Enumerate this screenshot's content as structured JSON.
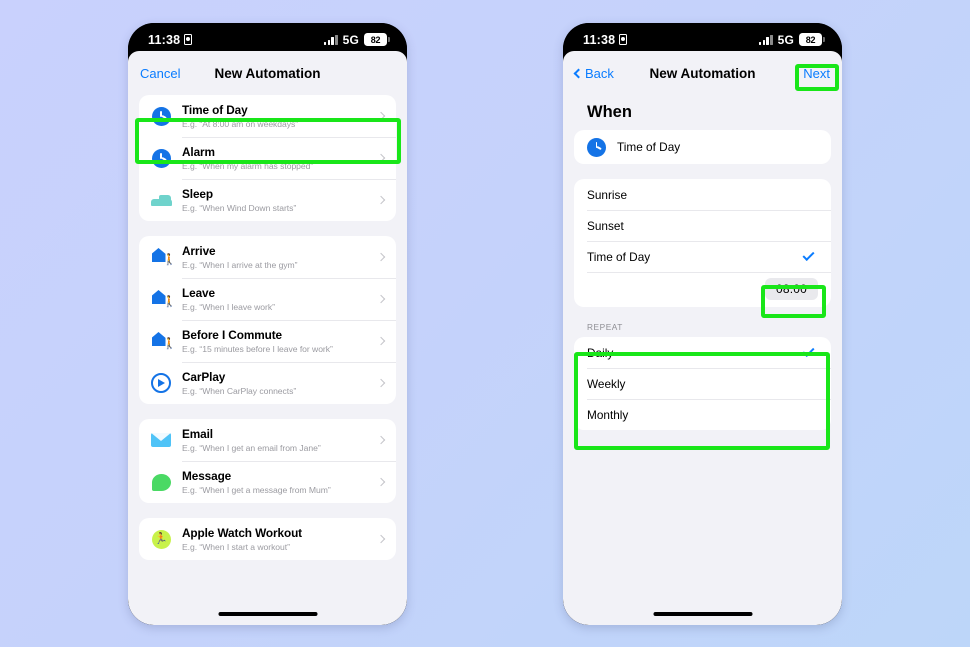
{
  "background": {
    "from": "#c9d1fd",
    "to": "#bdd6f9"
  },
  "accent": "#0a7cff",
  "highlight_color": "#19e619",
  "status_bar": {
    "time": "11:38",
    "lock_icon": "recording-indicator-icon",
    "signal_icon": "cellular-bars-icon",
    "network": "5G",
    "battery": "82"
  },
  "left_phone": {
    "nav": {
      "left_label": "Cancel",
      "title": "New Automation"
    },
    "groups": [
      {
        "rows": [
          {
            "icon": "clock-icon",
            "title": "Time of Day",
            "subtitle": "E.g. “At 8:00 am on weekdays”",
            "highlighted": true
          },
          {
            "icon": "clock-icon",
            "title": "Alarm",
            "subtitle": "E.g. “When my alarm has stopped”"
          },
          {
            "icon": "bed-icon",
            "title": "Sleep",
            "subtitle": "E.g. “When Wind Down starts”"
          }
        ]
      },
      {
        "rows": [
          {
            "icon": "home-arrive-icon",
            "title": "Arrive",
            "subtitle": "E.g. “When I arrive at the gym”"
          },
          {
            "icon": "home-leave-icon",
            "title": "Leave",
            "subtitle": "E.g. “When I leave work”"
          },
          {
            "icon": "home-commute-icon",
            "title": "Before I Commute",
            "subtitle": "E.g. “15 minutes before I leave for work”"
          },
          {
            "icon": "carplay-icon",
            "title": "CarPlay",
            "subtitle": "E.g. “When CarPlay connects”"
          }
        ]
      },
      {
        "rows": [
          {
            "icon": "mail-icon",
            "title": "Email",
            "subtitle": "E.g. “When I get an email from Jane”"
          },
          {
            "icon": "message-icon",
            "title": "Message",
            "subtitle": "E.g. “When I get a message from Mum”"
          }
        ]
      },
      {
        "rows": [
          {
            "icon": "watch-workout-icon",
            "title": "Apple Watch Workout",
            "subtitle": "E.g. “When I start a workout”"
          }
        ]
      }
    ]
  },
  "right_phone": {
    "nav": {
      "back_label": "Back",
      "title": "New Automation",
      "next_label": "Next"
    },
    "when_heading": "When",
    "trigger": {
      "icon": "clock-icon",
      "label": "Time of Day"
    },
    "time_options": [
      {
        "label": "Sunrise",
        "checked": false
      },
      {
        "label": "Sunset",
        "checked": false
      },
      {
        "label": "Time of Day",
        "checked": true
      }
    ],
    "time_value": "08:00",
    "repeat_header": "REPEAT",
    "repeat_options": [
      {
        "label": "Daily",
        "checked": true
      },
      {
        "label": "Weekly",
        "checked": false
      },
      {
        "label": "Monthly",
        "checked": false
      }
    ]
  }
}
